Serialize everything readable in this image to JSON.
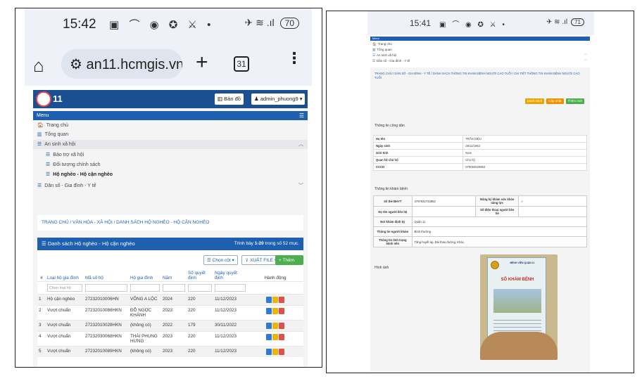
{
  "left": {
    "status": {
      "time": "15:42",
      "icons": "▣ ⌒ ◉ ✪ ⚔ •",
      "right_icons": "✈ ≋ .ıl",
      "battery": "70"
    },
    "browser": {
      "url": "an11.hcmgis.vn",
      "tab_count": "31",
      "home_icon": "home-icon",
      "plus_icon": "+",
      "more_icon": "⋮"
    },
    "app_header": {
      "brand": "11",
      "map_btn": "Bản đồ",
      "user_btn": "admin_phuong9"
    },
    "menu": {
      "title": "Menu",
      "items": [
        {
          "label": "Trang chủ",
          "icon": "🏠"
        },
        {
          "label": "Tổng quan",
          "icon": "▥"
        },
        {
          "label": "An sinh xã hội",
          "icon": "☰"
        },
        {
          "label": "Bảo trợ xã hội",
          "icon": "☰"
        },
        {
          "label": "Đối tượng chính sách",
          "icon": "☰"
        },
        {
          "label": "Hộ nghèo - Hộ cận nghèo",
          "icon": "☰"
        },
        {
          "label": "Dân số - Gia đình - Y tế",
          "icon": "☰"
        }
      ]
    },
    "breadcrumb": "TRANG CHỦ / VĂN HÓA - XÃ HỘI / DANH SÁCH HỘ NGHÈO - HỘ CẬN NGHÈO",
    "list": {
      "title": "Danh sách Hộ nghèo - Hộ cận nghèo",
      "count_prefix": "Trình bày ",
      "count_range": "1-20",
      "count_suffix": " trong số 52 mục.",
      "choose_cols": "Chọn cột",
      "export": "XUẤT FILE",
      "add_new": "+ Thêm mới",
      "columns": [
        "#",
        "Loại hộ gia đình",
        "Mã số hộ",
        "Hộ gia đình",
        "Năm",
        "Số quyết định",
        "Ngày quyết định",
        "Hành động"
      ],
      "filter_placeholder": "Chọn loại hộ",
      "rows": [
        {
          "n": "1",
          "type": "Hộ cận nghèo",
          "code": "27232010006HN",
          "name": "VÕNG A LỘC",
          "year": "2024",
          "dec": "220",
          "date": "11/12/2023"
        },
        {
          "n": "2",
          "type": "Vượt chuẩn",
          "code": "27232010086HKN",
          "name": "ĐỖ NGỌC KHÁNH",
          "year": "2023",
          "dec": "220",
          "date": "11/12/2023"
        },
        {
          "n": "3",
          "type": "Vượt chuẩn",
          "code": "27232010028HKN",
          "name": "(không có)",
          "year": "2022",
          "dec": "179",
          "date": "30/11/2022"
        },
        {
          "n": "4",
          "type": "Vượt chuẩn",
          "code": "27232030068HKN",
          "name": "THÁI PHỤNG HƯNG",
          "year": "2023",
          "dec": "220",
          "date": "11/12/2023"
        },
        {
          "n": "5",
          "type": "Vượt chuẩn",
          "code": "27232010089HKN",
          "name": "(không có)",
          "year": "2023",
          "dec": "220",
          "date": "11/12/2023"
        }
      ]
    }
  },
  "right": {
    "status": {
      "time": "15:41",
      "icons": "▣ ⌒ ◉ ✪ ⚔ •",
      "right_icons": "✈ ≋ .ıl",
      "battery": "71"
    },
    "menu": {
      "title": "Menu",
      "items": [
        {
          "label": "Trang chủ",
          "icon": "🏠"
        },
        {
          "label": "Tổng quan",
          "icon": "▥"
        },
        {
          "label": "An sinh xã hội",
          "icon": "☰"
        },
        {
          "label": "Dân số - Gia đình - Y tế",
          "icon": "☰"
        }
      ]
    },
    "breadcrumb": "TRANG CHỦ / DÂN SỐ - GIA ĐÌNH - Y TẾ / DANH SÁCH THÔNG TIN KHÁM BỆNH NGƯỜI CAO TUỔI / CHI TIẾT THÔNG TIN KHÁM BỆNH NGƯỜI CAO TUỔI",
    "buttons": {
      "list": "Danh sách",
      "update": "Cập nhật",
      "add": "Thêm mới"
    },
    "citizen_section": "Thông tin công dân",
    "citizen": [
      {
        "label": "Họ tên",
        "value": "TRẦN DIỆU"
      },
      {
        "label": "Ngày sinh",
        "value": "29/11/1963"
      },
      {
        "label": "Giới tính",
        "value": "Nam"
      },
      {
        "label": "Quan hệ chủ hộ",
        "value": "Chủ hộ"
      },
      {
        "label": "CCCD",
        "value": "079063029953"
      }
    ],
    "exam_section": "Thông tin khám bệnh",
    "exam": {
      "bhyt_label": "Số thẻ BHYT",
      "bhyt_value": "4797932733952",
      "reg_label": "Đăng ký khám sức khỏe năng lực",
      "reg_value": "✓",
      "rel_name_label": "Họ tên người liên hệ",
      "rel_name_value": "",
      "rel_phone_label": "Số điện thoại người liên hệ",
      "rel_phone_value": "",
      "place_label": "Nơi khám định kỳ",
      "place_value": "Quận 11",
      "info_label": "Thông tin người khám",
      "info_value": "Bình thường",
      "health_label": "Thông tin tình trạng bệnh nền",
      "health_value": "Tăng huyết áp, Đái tháo đường, Khác,"
    },
    "image_section": "Hình ảnh",
    "photo": {
      "hospital": "BỆNH VIỆN QUẬN 11",
      "title": "SỔ KHÁM BỆNH"
    }
  }
}
